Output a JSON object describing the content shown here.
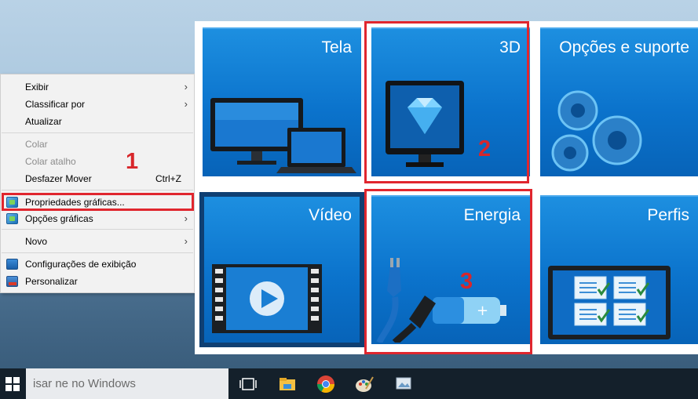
{
  "context_menu": {
    "items": [
      {
        "label": "Exibir",
        "submenu": true,
        "disabled": false
      },
      {
        "label": "Classificar por",
        "submenu": true,
        "disabled": false
      },
      {
        "label": "Atualizar",
        "submenu": false,
        "disabled": false
      },
      {
        "label": "Colar",
        "submenu": false,
        "disabled": true
      },
      {
        "label": "Colar atalho",
        "submenu": false,
        "disabled": true
      },
      {
        "label": "Desfazer Mover",
        "shortcut": "Ctrl+Z",
        "submenu": false,
        "disabled": false
      },
      {
        "label": "Propriedades gráficas...",
        "submenu": false,
        "disabled": false,
        "icon": "intel-graphics-icon"
      },
      {
        "label": "Opções gráficas",
        "submenu": true,
        "disabled": false,
        "icon": "intel-graphics-icon"
      },
      {
        "label": "Novo",
        "submenu": true,
        "disabled": false
      },
      {
        "label": "Configurações de exibição",
        "submenu": false,
        "disabled": false,
        "icon": "display-settings-icon"
      },
      {
        "label": "Personalizar",
        "submenu": false,
        "disabled": false,
        "icon": "personalize-icon"
      }
    ],
    "submenu_arrow": "›"
  },
  "annotations": {
    "step1": "1",
    "step2": "2",
    "step3": "3",
    "color": "#e0262e"
  },
  "tiles": [
    {
      "title": "Tela",
      "icon": "monitor-laptop-icon"
    },
    {
      "title": "3D",
      "icon": "diamond-monitor-icon"
    },
    {
      "title": "Opções e suporte",
      "icon": "gears-icon"
    },
    {
      "title": "Vídeo",
      "icon": "video-play-icon"
    },
    {
      "title": "Energia",
      "icon": "plug-battery-icon"
    },
    {
      "title": "Perfis",
      "icon": "profile-checklist-icon"
    }
  ],
  "taskbar": {
    "search_text": "isar ne no Windows",
    "apps": [
      "task-view-icon",
      "file-explorer-icon",
      "chrome-icon",
      "paint-icon",
      "photos-icon"
    ]
  },
  "colors": {
    "tile_blue": "#0b73cc",
    "taskbar": "#14202b",
    "menu_bg": "#f2f2f2"
  }
}
